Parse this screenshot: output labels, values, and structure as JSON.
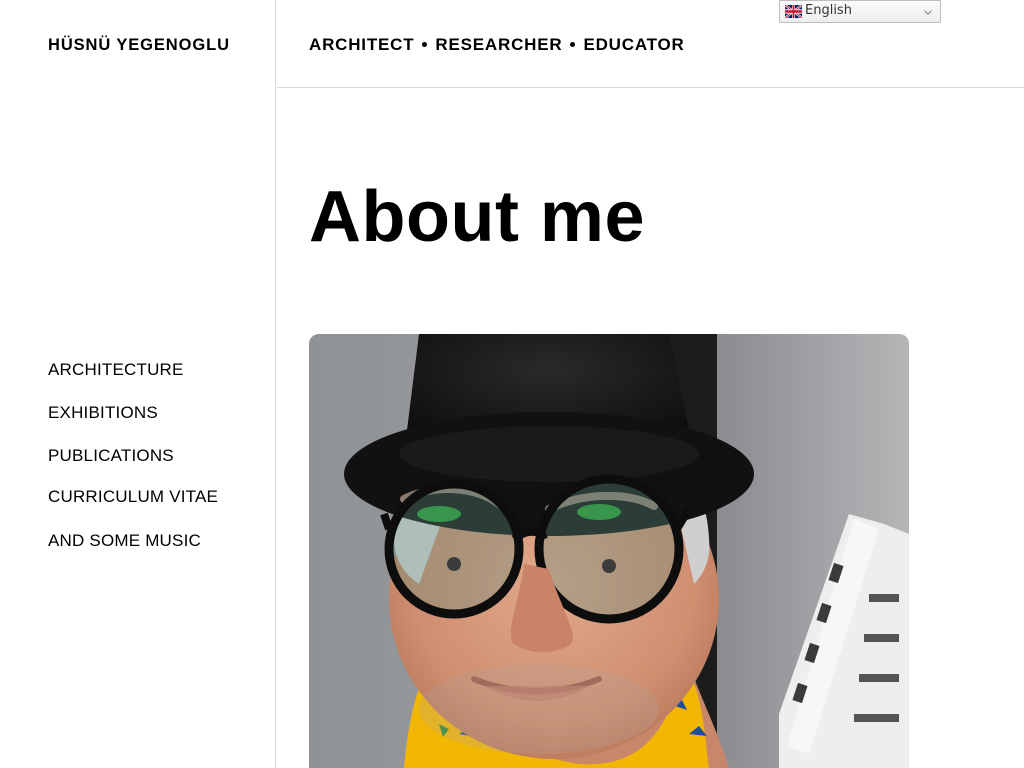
{
  "site": {
    "title": "HÜSNÜ YEGENOGLU"
  },
  "header": {
    "tagline": [
      "ARCHITECT",
      "RESEARCHER",
      "EDUCATOR"
    ],
    "language": {
      "selected": "English",
      "flag_icon": "uk-flag-icon"
    }
  },
  "nav": {
    "items": [
      {
        "label": "ARCHITECTURE"
      },
      {
        "label": "EXHIBITIONS"
      },
      {
        "label": "PUBLICATIONS"
      },
      {
        "label": "CURRICULUM VITAE"
      },
      {
        "label": "AND SOME MUSIC"
      }
    ]
  },
  "main": {
    "heading": "About me",
    "portrait": {
      "kind": "photo",
      "subject": "portrait-photo"
    }
  },
  "colors": {
    "text": "#000000",
    "background": "#ffffff",
    "divider": "#d9d9d9",
    "scarf": "#f2b705"
  }
}
